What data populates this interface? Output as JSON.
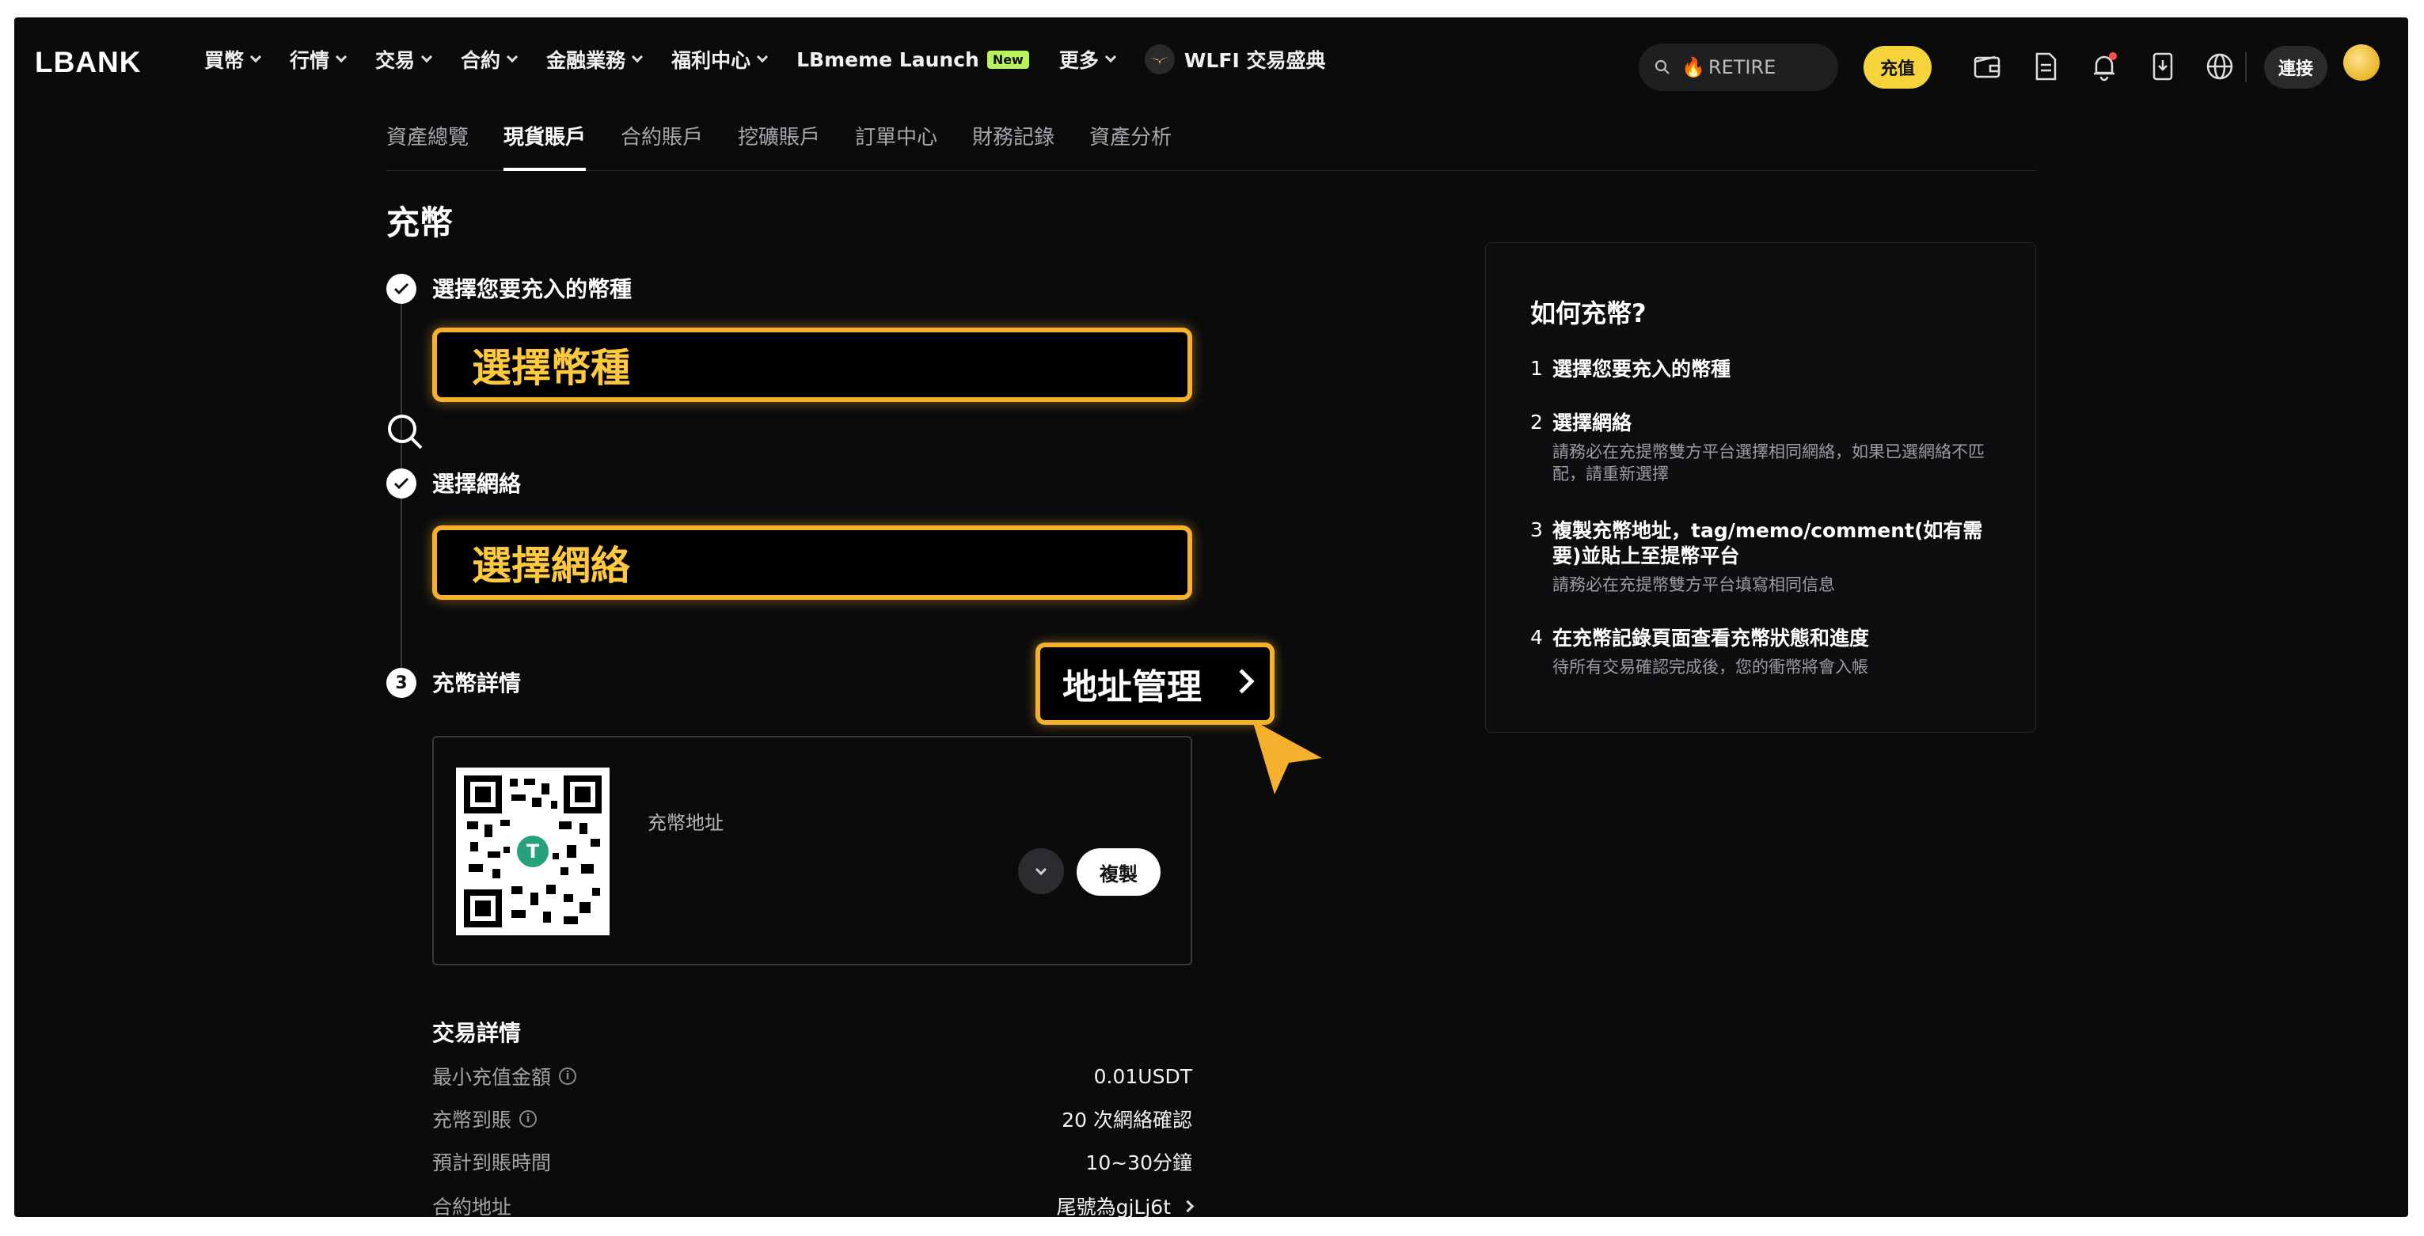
{
  "nav": {
    "logo": "LBANK",
    "items": [
      {
        "label": "買幣",
        "chevron": true
      },
      {
        "label": "行情",
        "chevron": true
      },
      {
        "label": "交易",
        "chevron": true
      },
      {
        "label": "合約",
        "chevron": true
      },
      {
        "label": "金融業務",
        "chevron": true
      },
      {
        "label": "福利中心",
        "chevron": true
      },
      {
        "label": "LBmeme Launch",
        "badge": "New",
        "chevron": false
      },
      {
        "label": "更多",
        "chevron": true
      }
    ],
    "promo": "WLFI 交易盛典",
    "search_text": "RETIRE",
    "charge_label": "充值",
    "connect_label": "連接"
  },
  "subtabs": [
    "資產總覽",
    "現貨賬戶",
    "合約賬戶",
    "挖礦賬戶",
    "訂單中心",
    "財務記錄",
    "資產分析"
  ],
  "active_subtab": 1,
  "page": {
    "title": "充幣",
    "step1_label": "選擇您要充入的幣種",
    "step1_box": "選擇幣種",
    "step2_label": "選擇網絡",
    "step2_box": "選擇網絡",
    "step3_num": "3",
    "step3_label": "充幣詳情",
    "address_mgmt": "地址管理",
    "qr_label": "充幣地址",
    "copy_label": "複製"
  },
  "tx": {
    "title": "交易詳情",
    "rows": [
      {
        "key": "最小充值金額",
        "value": "0.01USDT",
        "info": true,
        "chevron": false
      },
      {
        "key": "充幣到賬",
        "value": "20 次網絡確認",
        "info": true,
        "chevron": false
      },
      {
        "key": "預計到賬時間",
        "value": "10~30分鐘",
        "info": false,
        "chevron": false
      },
      {
        "key": "合約地址",
        "value": "尾號為gjLj6t",
        "info": false,
        "chevron": true
      }
    ]
  },
  "howto": {
    "title": "如何充幣?",
    "steps": [
      {
        "num": "1",
        "head": "選擇您要充入的幣種",
        "desc": ""
      },
      {
        "num": "2",
        "head": "選擇網絡",
        "desc": "請務必在充提幣雙方平台選擇相同網絡，如果已選網絡不匹配，請重新選擇"
      },
      {
        "num": "3",
        "head": "複製充幣地址，tag/memo/comment(如有需要)並貼上至提幣平台",
        "desc": "請務必在充提幣雙方平台填寫相同信息"
      },
      {
        "num": "4",
        "head": "在充幣記錄頁面查看充幣狀態和進度",
        "desc": "待所有交易確認完成後，您的衝幣將會入帳"
      }
    ]
  },
  "colors": {
    "accent": "#f6b02d",
    "highlight_text": "#ffc93d",
    "charge_button": "#f5d33a",
    "new_badge": "#b8f35a",
    "background": "#0b0b0c"
  }
}
